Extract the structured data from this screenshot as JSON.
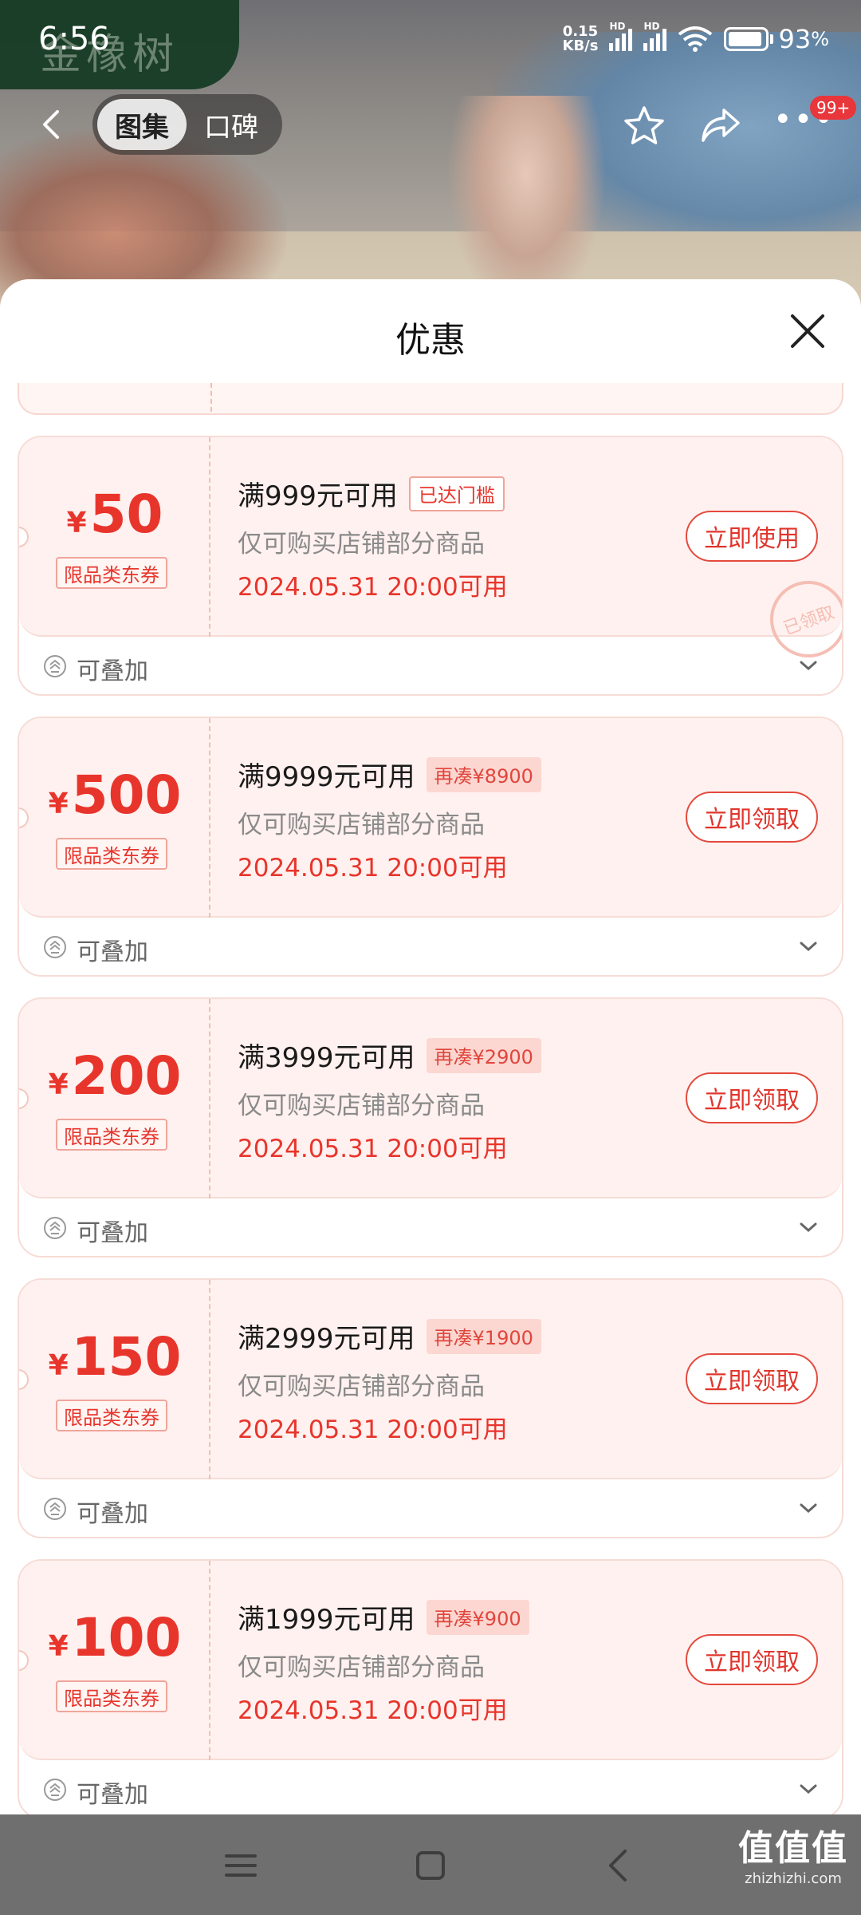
{
  "status_bar": {
    "time": "6:56",
    "net_speed_value": "0.15",
    "net_speed_unit": "KB/s",
    "signal_label": "HD",
    "battery": "93",
    "battery_unit": "%"
  },
  "background": {
    "brand_text": "金橡树"
  },
  "nav": {
    "tabs": [
      {
        "label": "图集",
        "active": true
      },
      {
        "label": "口碑",
        "active": false
      }
    ],
    "badge": "99+"
  },
  "sheet": {
    "title": "优惠",
    "coupons": [
      {
        "currency": "¥",
        "amount": "50",
        "type_label": "限品类东券",
        "condition": "满999元可用",
        "condition_tag": "已达门槛",
        "tag_kind": "reached",
        "description": "仅可购买店铺部分商品",
        "valid": "2024.05.31 20:00可用",
        "action": "立即使用",
        "stamp": "已领取",
        "stack_label": "可叠加"
      },
      {
        "currency": "¥",
        "amount": "500",
        "type_label": "限品类东券",
        "condition": "满9999元可用",
        "condition_tag": "再凑¥8900",
        "tag_kind": "need",
        "description": "仅可购买店铺部分商品",
        "valid": "2024.05.31 20:00可用",
        "action": "立即领取",
        "stamp": "",
        "stack_label": "可叠加"
      },
      {
        "currency": "¥",
        "amount": "200",
        "type_label": "限品类东券",
        "condition": "满3999元可用",
        "condition_tag": "再凑¥2900",
        "tag_kind": "need",
        "description": "仅可购买店铺部分商品",
        "valid": "2024.05.31 20:00可用",
        "action": "立即领取",
        "stamp": "",
        "stack_label": "可叠加"
      },
      {
        "currency": "¥",
        "amount": "150",
        "type_label": "限品类东券",
        "condition": "满2999元可用",
        "condition_tag": "再凑¥1900",
        "tag_kind": "need",
        "description": "仅可购买店铺部分商品",
        "valid": "2024.05.31 20:00可用",
        "action": "立即领取",
        "stamp": "",
        "stack_label": "可叠加"
      },
      {
        "currency": "¥",
        "amount": "100",
        "type_label": "限品类东券",
        "condition": "满1999元可用",
        "condition_tag": "再凑¥900",
        "tag_kind": "need",
        "description": "仅可购买店铺部分商品",
        "valid": "2024.05.31 20:00可用",
        "action": "立即领取",
        "stamp": "",
        "stack_label": "可叠加"
      }
    ]
  },
  "watermark": {
    "main": "值值值",
    "sub": "zhizhizhi.com"
  },
  "colors": {
    "accent": "#e8352c",
    "card_bg": "#fff1ef",
    "border": "#f7dcd6",
    "nav_bar": "#6f6f6f"
  },
  "icons": [
    "back-icon",
    "star-icon",
    "share-icon",
    "more-icon",
    "close-icon",
    "stack-icon",
    "chevron-down-icon",
    "menu-icon",
    "home-icon",
    "system-back-icon"
  ]
}
